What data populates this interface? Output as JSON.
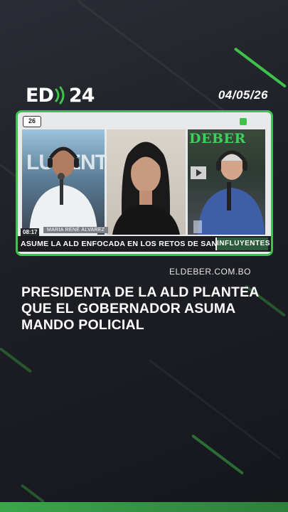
{
  "brand": {
    "logo_left": "ED",
    "logo_right": "24",
    "accent": "#3ec24a"
  },
  "date": "04/05/26",
  "video": {
    "channel_badge": "26",
    "time": "08:17",
    "guest_name": "MARÍA RENÉ ÁLVAREZ",
    "ticker": "ASUME LA ALD ENFOCADA EN LOS RETOS DE SANTA CRUZ",
    "show_tag": "INFLUYENTES",
    "left_backdrop": "LUYENTE",
    "right_backdrop": "DEBER"
  },
  "source": "ELDEBER.COM.BO",
  "headline": [
    "PRESIDENTA DE LA ALD PLANTEA",
    "QUE EL GOBERNADOR ASUMA",
    "MANDO POLICIAL"
  ]
}
